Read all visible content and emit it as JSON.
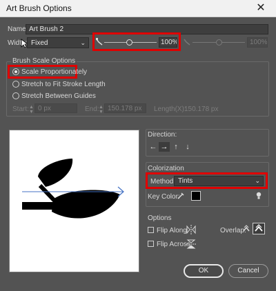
{
  "window": {
    "title": "Art Brush Options",
    "close_glyph": "✕"
  },
  "name": {
    "label": "Name:",
    "value": "Art Brush 2"
  },
  "width": {
    "label": "Width:",
    "mode": "Fixed",
    "percent": "100%",
    "variation_percent": "100%"
  },
  "brush_scale": {
    "title": "Brush Scale Options",
    "options": [
      "Scale Proportionately",
      "Stretch to Fit Stroke Length",
      "Stretch Between Guides"
    ],
    "selected_index": 0,
    "start_label": "Start:",
    "start_value": "0 px",
    "end_label": "End:",
    "end_value": "150.178 px",
    "length_label": "Length(X):",
    "length_value": "150.178 px"
  },
  "direction": {
    "label": "Direction:",
    "arrows": [
      "←",
      "→",
      "↑",
      "↓"
    ],
    "active_index": 1
  },
  "colorization": {
    "title": "Colorization",
    "method_label": "Method:",
    "method_value": "Tints",
    "key_color_label": "Key Color:",
    "key_color": "#000000"
  },
  "options": {
    "title": "Options",
    "flip_along": "Flip Along",
    "flip_across": "Flip Across",
    "overlap_label": "Overlap:"
  },
  "buttons": {
    "ok": "OK",
    "cancel": "Cancel"
  },
  "colors": {
    "dialog_bg": "#535353",
    "highlight": "#e00000",
    "guide_line": "#4472c4"
  },
  "icons": [
    "close-icon",
    "chevron-down-icon",
    "stroke-width-icon",
    "eyedropper-icon",
    "tip-icon",
    "flip-along-icon",
    "flip-across-icon",
    "overlap-icon"
  ]
}
